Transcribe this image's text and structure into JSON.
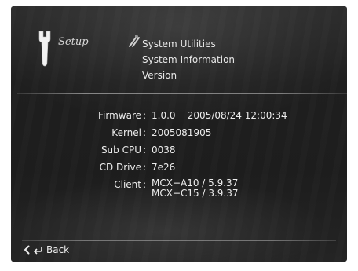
{
  "header": {
    "section_label": "Setup",
    "section_icon": "wrench-icon",
    "menu_icon": "screwdriver-wrench-icon",
    "menu_items": [
      "System Utilities",
      "System Information",
      "Version"
    ]
  },
  "info": {
    "rows": [
      {
        "label": "Firmware",
        "value": "1.0.0    2005/08/24 12:00:34"
      },
      {
        "label": "Kernel",
        "value": "2005081905"
      },
      {
        "label": "Sub CPU",
        "value": "0038"
      },
      {
        "label": "CD Drive",
        "value": "7e26"
      }
    ],
    "client": {
      "label": "Client",
      "values": [
        "MCX−A10 / 5.9.37",
        "MCX−C15 / 3.9.37"
      ]
    },
    "separator": ":"
  },
  "footer": {
    "back_label": "Back",
    "back_icons": [
      "left-chevron-icon",
      "return-arrow-icon"
    ]
  },
  "colors": {
    "background": "#1f1f1f",
    "text": "#e8e8e8"
  }
}
